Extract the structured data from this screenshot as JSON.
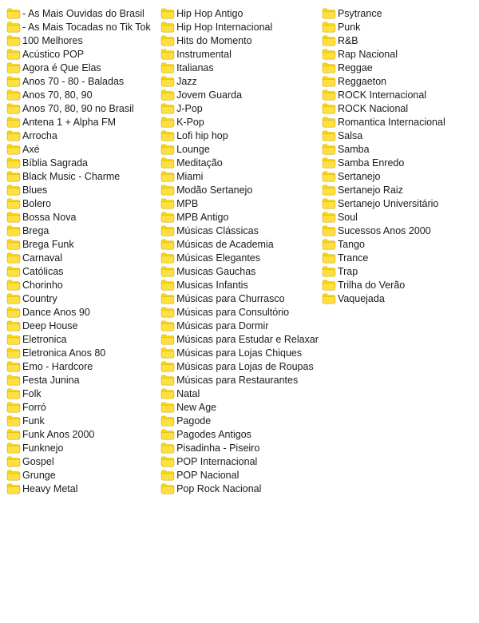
{
  "columns": [
    {
      "id": "col1",
      "items": [
        "- As Mais Ouvidas do Brasil",
        "- As Mais Tocadas no Tik Tok",
        "100 Melhores",
        "Acústico POP",
        "Agora é Que Elas",
        "Anos 70 - 80 - Baladas",
        "Anos 70, 80, 90",
        "Anos 70, 80, 90 no Brasil",
        "Antena 1 + Alpha FM",
        "Arrocha",
        "Axé",
        "Bíblia Sagrada",
        "Black Music - Charme",
        "Blues",
        "Bolero",
        "Bossa Nova",
        "Brega",
        "Brega Funk",
        "Carnaval",
        "Católicas",
        "Chorinho",
        "Country",
        "Dance Anos 90",
        "Deep House",
        "Eletronica",
        "Eletronica Anos 80",
        "Emo - Hardcore",
        "Festa Junina",
        "Folk",
        "Forró",
        "Funk",
        "Funk Anos 2000",
        "Funknejo",
        "Gospel",
        "Grunge",
        "Heavy Metal"
      ]
    },
    {
      "id": "col2",
      "items": [
        "Hip Hop Antigo",
        "Hip Hop Internacional",
        "Hits do Momento",
        "Instrumental",
        "Italianas",
        "Jazz",
        "Jovem Guarda",
        "J-Pop",
        "K-Pop",
        "Lofi hip hop",
        "Lounge",
        "Meditação",
        "Miami",
        "Modão Sertanejo",
        "MPB",
        "MPB Antigo",
        "Músicas Clássicas",
        "Músicas de Academia",
        "Músicas Elegantes",
        "Musicas Gauchas",
        "Musicas Infantis",
        "Músicas para Churrasco",
        "Músicas para Consultório",
        "Músicas para Dormir",
        "Músicas para Estudar e Relaxar",
        "Músicas para Lojas Chiques",
        "Músicas para Lojas de Roupas",
        "Músicas para Restaurantes",
        "Natal",
        "New Age",
        "Pagode",
        "Pagodes Antigos",
        "Pisadinha - Piseiro",
        "POP Internacional",
        "POP Nacional",
        "Pop Rock Nacional"
      ]
    },
    {
      "id": "col3",
      "items": [
        "Psytrance",
        "Punk",
        "R&B",
        "Rap Nacional",
        "Reggae",
        "Reggaeton",
        "ROCK Internacional",
        "ROCK Nacional",
        "Romantica Internacional",
        "Salsa",
        "Samba",
        "Samba Enredo",
        "Sertanejo",
        "Sertanejo Raiz",
        "Sertanejo Universitário",
        "Soul",
        "Sucessos Anos 2000",
        "Tango",
        "Trance",
        "Trap",
        "Trilha do Verão",
        "Vaquejada"
      ]
    }
  ],
  "folder_icon_color": "#FFD700"
}
